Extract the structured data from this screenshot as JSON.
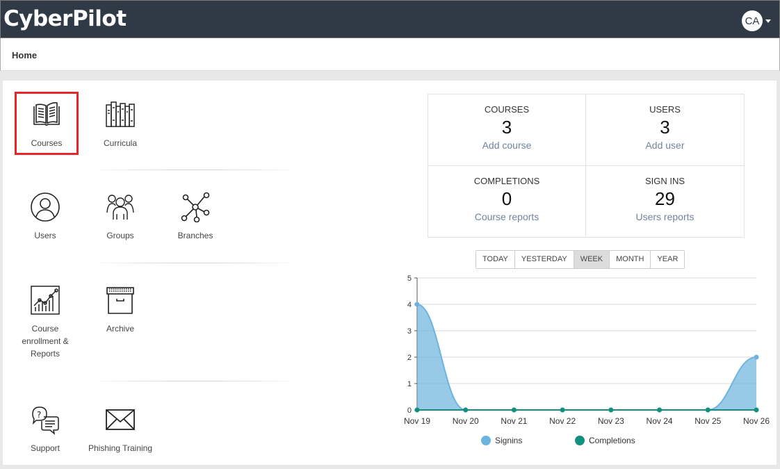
{
  "header": {
    "logo": "CyberPilot",
    "user_initials": "CA"
  },
  "breadcrumb": {
    "title": "Home"
  },
  "tiles": {
    "courses": "Courses",
    "curricula": "Curricula",
    "users": "Users",
    "groups": "Groups",
    "branches": "Branches",
    "course_reports": "Course enrollment & Reports",
    "archive": "Archive",
    "support": "Support",
    "phishing": "Phishing Training"
  },
  "stats": {
    "courses": {
      "name": "COURSES",
      "value": "3",
      "link": "Add course"
    },
    "users": {
      "name": "USERS",
      "value": "3",
      "link": "Add user"
    },
    "completions": {
      "name": "COMPLETIONS",
      "value": "0",
      "link": "Course reports"
    },
    "signins": {
      "name": "SIGN INS",
      "value": "29",
      "link": "Users reports"
    }
  },
  "range_buttons": [
    "TODAY",
    "YESTERDAY",
    "WEEK",
    "MONTH",
    "YEAR"
  ],
  "range_selected": "WEEK",
  "chart_data": {
    "type": "area",
    "x": [
      "Nov 19",
      "Nov 20",
      "Nov 21",
      "Nov 22",
      "Nov 23",
      "Nov 24",
      "Nov 25",
      "Nov 26"
    ],
    "yticks": [
      0,
      1,
      2,
      3,
      4,
      5
    ],
    "ylim": [
      0,
      5
    ],
    "grid": true,
    "legend_position": "bottom",
    "series": [
      {
        "name": "Signins",
        "values": [
          4,
          0,
          0,
          0,
          0,
          0,
          0,
          2
        ],
        "color": "#6cb4de"
      },
      {
        "name": "Completions",
        "values": [
          0,
          0,
          0,
          0,
          0,
          0,
          0,
          0
        ],
        "color": "#119080"
      }
    ]
  },
  "colors": {
    "topbar": "#2f3a46",
    "selected_outline": "#e8262a",
    "link": "#6e85a0"
  }
}
